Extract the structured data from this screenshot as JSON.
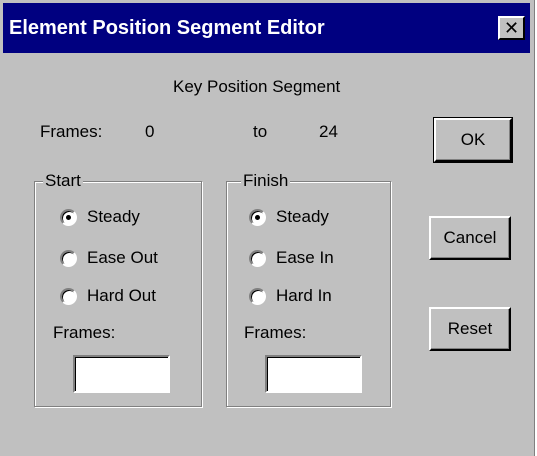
{
  "window": {
    "title": "Element Position Segment Editor",
    "close_glyph": "✕"
  },
  "segment": {
    "heading": "Key Position Segment",
    "frames_label": "Frames:",
    "from_value": "0",
    "to_label": "to",
    "to_value": "24"
  },
  "start_group": {
    "legend": "Start",
    "options": [
      {
        "label": "Steady",
        "checked": true
      },
      {
        "label": "Ease Out",
        "checked": false
      },
      {
        "label": "Hard Out",
        "checked": false
      }
    ],
    "frames_label": "Frames:",
    "frames_value": ""
  },
  "finish_group": {
    "legend": "Finish",
    "options": [
      {
        "label": "Steady",
        "checked": true
      },
      {
        "label": "Ease In",
        "checked": false
      },
      {
        "label": "Hard In",
        "checked": false
      }
    ],
    "frames_label": "Frames:",
    "frames_value": ""
  },
  "buttons": {
    "ok": "OK",
    "cancel": "Cancel",
    "reset": "Reset"
  }
}
